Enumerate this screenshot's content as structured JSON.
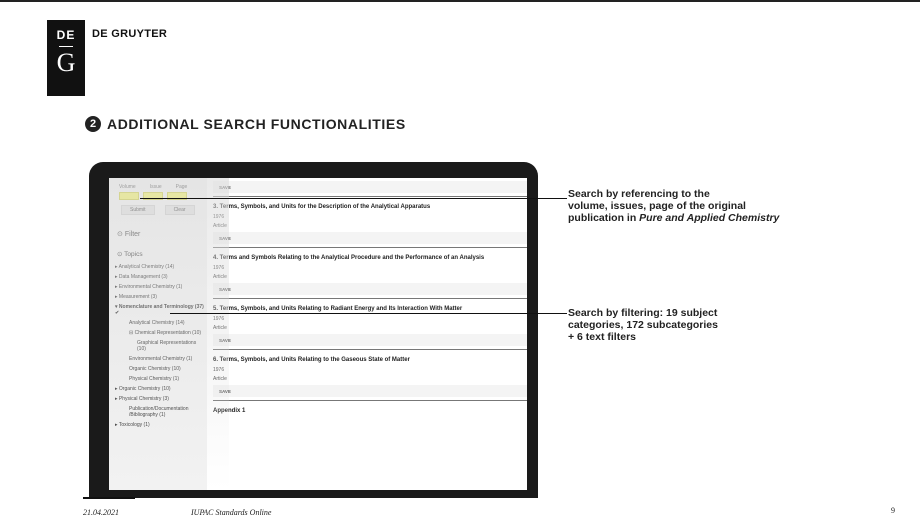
{
  "brand": {
    "logo_top": "DE",
    "logo_bottom": "G",
    "name": "DE GRUYTER"
  },
  "heading": {
    "number": "2",
    "title": "ADDITIONAL SEARCH FUNCTIONALITIES"
  },
  "screen": {
    "field_labels": [
      "Volume",
      "Issue",
      "Page"
    ],
    "submit_label": "Submit",
    "clear_label": "Clear",
    "filter_label": "Filter",
    "topics_label": "Topics",
    "topics": [
      "Analytical Chemistry (14)",
      "Data Management (3)",
      "Environmental Chemistry (1)",
      "Measurement (3)",
      "Nomenclature and Terminology (37) ✔",
      "Analytical Chemistry (14)",
      "Chemical Representation (10)",
      "Graphical Representations (10)",
      "Environmental Chemistry (1)",
      "Organic Chemistry (10)",
      "Physical Chemistry (1)",
      "Organic Chemistry (10)",
      "Physical Chemistry (3)",
      "Publication/Documentation /Bibliography (1)",
      "Toxicology (1)"
    ],
    "save_label": "SAVE",
    "results": [
      {
        "title": "3. Terms, Symbols, and Units for the Description of the Analytical Apparatus",
        "year": "1976",
        "type": "Article"
      },
      {
        "title": "4. Terms and Symbols Relating to the Analytical Procedure and the Performance of an Analysis",
        "year": "1976",
        "type": "Article"
      },
      {
        "title": "5. Terms, Symbols, and Units Relating to Radiant Energy and Its Interaction With Matter",
        "year": "1976",
        "type": "Article"
      },
      {
        "title": "6. Terms, Symbols, and Units Relating to the Gaseous State of Matter",
        "year": "1976",
        "type": "Article"
      }
    ],
    "appendix_label": "Appendix 1"
  },
  "notes": {
    "note1_line1": "Search by referencing to the",
    "note1_line2": "volume, issues, page of the original",
    "note1_line3": "publication in ",
    "note1_italic": "Pure and Applied Chemistry",
    "note2_line1": "Search by filtering: 19 subject",
    "note2_line2": "categories, 172 subcategories",
    "note2_line3": "+ 6 text filters"
  },
  "footer": {
    "date": "21.04.2021",
    "title": "IUPAC Standards Online",
    "page": "9"
  }
}
